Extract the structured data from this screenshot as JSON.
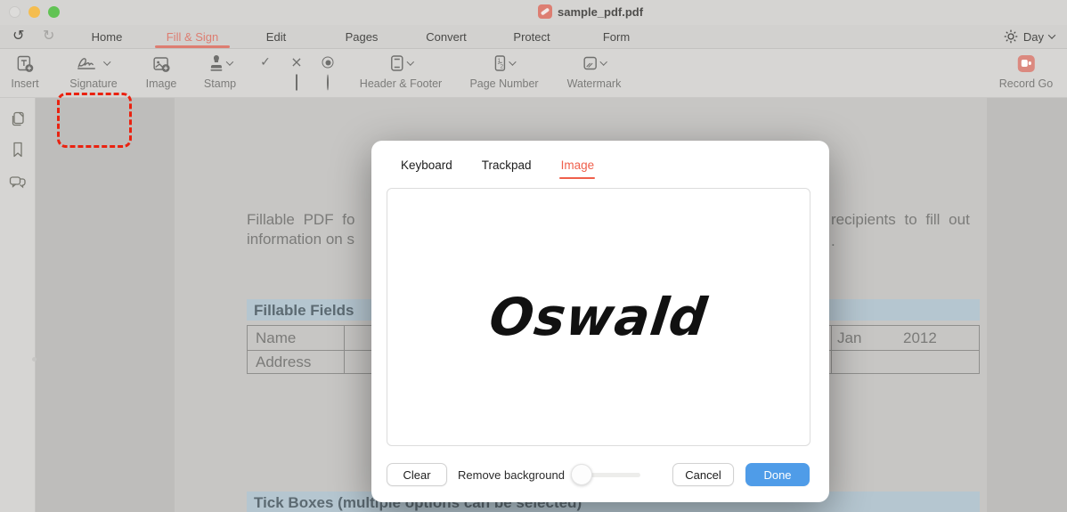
{
  "window": {
    "title": "sample_pdf.pdf"
  },
  "tab_bar": {
    "tabs": [
      {
        "label": "Home"
      },
      {
        "label": "Fill & Sign"
      },
      {
        "label": "Edit"
      },
      {
        "label": "Pages"
      },
      {
        "label": "Convert"
      },
      {
        "label": "Protect"
      },
      {
        "label": "Form"
      }
    ],
    "active_tab": "Fill & Sign",
    "undo_glyph": "↺",
    "redo_glyph": "↻",
    "theme_label": "Day"
  },
  "toolbar": {
    "insert_label": "Insert",
    "signature_label": "Signature",
    "image_label": "Image",
    "stamp_label": "Stamp",
    "header_footer_label": "Header & Footer",
    "page_number_label": "Page Number",
    "watermark_label": "Watermark",
    "record_label": "Record Go",
    "check_glyph": "✓",
    "cross_glyph": "×"
  },
  "document": {
    "para_line1_left": "Fillable  PDF  fo",
    "para_line1_right": "recipients  to  fill  out",
    "para_line2_left": "information on s",
    "para_line2_right": ".",
    "fillable_fields_header": "Fillable Fields",
    "row1_label": "Name",
    "row2_label": "Address",
    "date_month": "Jan",
    "date_year": "2012",
    "tick_boxes_header": "Tick Boxes (multiple options can be selected)"
  },
  "dialog": {
    "tabs": [
      {
        "label": "Keyboard"
      },
      {
        "label": "Trackpad"
      },
      {
        "label": "Image"
      }
    ],
    "active_tab": "Image",
    "signature_text": "Oswald",
    "clear_label": "Clear",
    "remove_background_label": "Remove background",
    "cancel_label": "Cancel",
    "done_label": "Done"
  },
  "colors": {
    "accent_red": "#ef5f4b",
    "muted_red": "#dd7d71",
    "done_blue": "#4f9ce8",
    "annotation_red": "#ea2210",
    "band_blue": "#b5c6d0",
    "record_red": "#db897f"
  }
}
